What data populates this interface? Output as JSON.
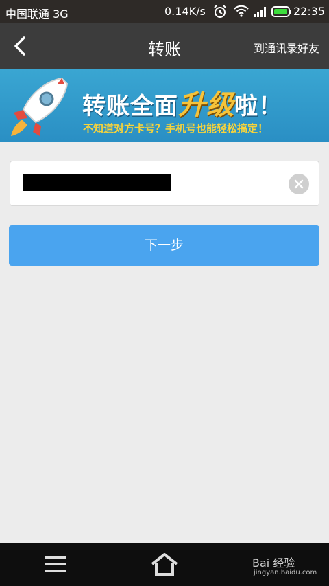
{
  "status_bar": {
    "carrier": "中国联通 3G",
    "speed": "0.14K/s",
    "time": "22:35",
    "icons": [
      "alarm-icon",
      "wifi-icon",
      "signal-icon",
      "battery-icon"
    ]
  },
  "nav": {
    "title": "转账",
    "contacts_link": "到通讯录好友",
    "back_icon": "chevron-left-icon"
  },
  "banner": {
    "headline_prefix": "转账全面",
    "headline_highlight": "升级",
    "headline_suffix": "啦！",
    "subline": "不知道对方卡号？手机号也能轻松搞定！"
  },
  "form": {
    "clear_icon": "close-icon"
  },
  "actions": {
    "next_label": "下一步"
  },
  "bottom_bar": {
    "icons": [
      "menu-icon",
      "home-icon"
    ],
    "watermark": "Bai 经验",
    "watermark_sub": "jingyan.baidu.com"
  },
  "colors": {
    "status_bg": "#2e2a27",
    "nav_bg": "#3c3c3c",
    "primary_button": "#4aa4ef",
    "page_bg": "#ececec",
    "banner_bg": "#3aa6d2"
  }
}
